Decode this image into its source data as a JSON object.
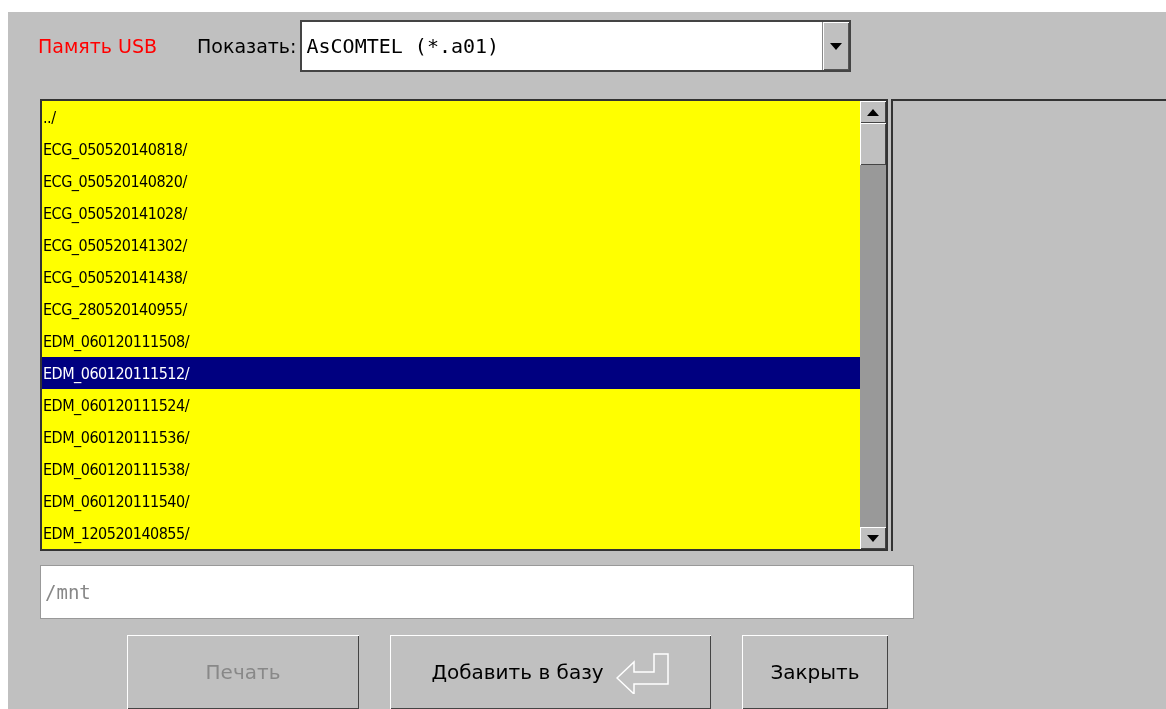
{
  "header": {
    "source_label": "Память USB",
    "filter_label": "Показать:",
    "filter_value": "AsCOMTEL (*.a01)"
  },
  "files": [
    {
      "name": "../",
      "selected": false
    },
    {
      "name": "ECG_050520140818/",
      "selected": false
    },
    {
      "name": "ECG_050520140820/",
      "selected": false
    },
    {
      "name": "ECG_050520141028/",
      "selected": false
    },
    {
      "name": "ECG_050520141302/",
      "selected": false
    },
    {
      "name": "ECG_050520141438/",
      "selected": false
    },
    {
      "name": "ECG_280520140955/",
      "selected": false
    },
    {
      "name": "EDM_060120111508/",
      "selected": false
    },
    {
      "name": "EDM_060120111512/",
      "selected": true
    },
    {
      "name": "EDM_060120111524/",
      "selected": false
    },
    {
      "name": "EDM_060120111536/",
      "selected": false
    },
    {
      "name": "EDM_060120111538/",
      "selected": false
    },
    {
      "name": "EDM_060120111540/",
      "selected": false
    },
    {
      "name": "EDM_120520140855/",
      "selected": false
    }
  ],
  "path_field": {
    "value": "/mnt"
  },
  "buttons": [
    {
      "label": "Печать",
      "disabled": true,
      "kind": "plain"
    },
    {
      "label": "Добавить в базу",
      "disabled": false,
      "kind": "enter"
    },
    {
      "label": "Закрыть",
      "disabled": false,
      "kind": "plain"
    }
  ]
}
